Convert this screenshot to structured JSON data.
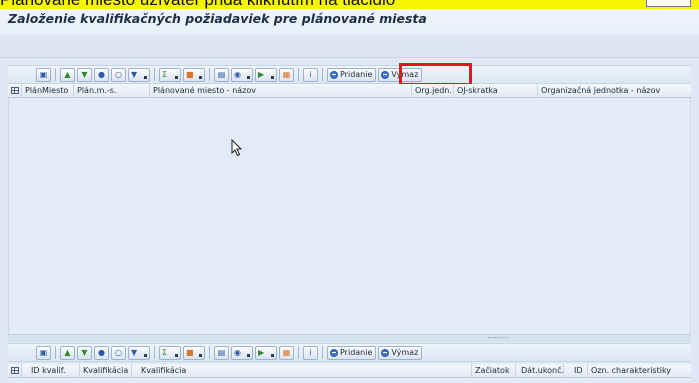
{
  "overlay": {
    "caption": "Plánované miesto užívateľ pridá kliknutím na  tlačidlo"
  },
  "window": {
    "title": "Založenie kvalifikačných požiadaviek pre plánované miesta"
  },
  "toolbar_top": {
    "add_label": "Pridanie",
    "remove_label": "Výmaz",
    "icons": [
      "details-icon",
      "sort-ascending-icon",
      "sort-descending-icon",
      "find-icon",
      "find-next-icon",
      "filter-icon",
      "total-icon",
      "subtotal-icon",
      "print-icon",
      "views-icon",
      "export-icon",
      "layout-icon",
      "info-icon"
    ]
  },
  "table_top": {
    "columns": [
      "PlánMiesto",
      "Plán.m.-s.",
      "Plánované miesto - názov",
      "Org.jedn.",
      "OJ-skratka",
      "Organizačná jednotka - názov"
    ]
  },
  "toolbar_bottom": {
    "add_label": "Pridanie",
    "remove_label": "Výmaz"
  },
  "table_bottom": {
    "columns": [
      "ID kvalif.",
      "Kvalifikácia",
      "Kvalifikácia",
      "Začiatok",
      "Dát.ukonč.",
      "ID",
      "Ozn. charakteristiky"
    ]
  },
  "colors": {
    "highlight": "#e8131b",
    "caption_band": "#f5f500",
    "background": "#dfe9f5"
  }
}
